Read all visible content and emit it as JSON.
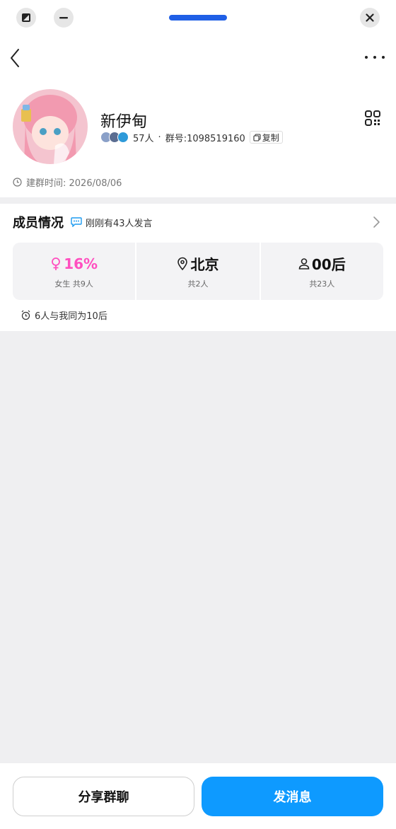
{
  "window": {
    "left_icon": "split-screen-icon",
    "minimize_icon": "minimize-icon",
    "close_icon": "close-icon"
  },
  "nav": {
    "back_icon": "back-arrow-icon",
    "more_icon": "more-dots-icon"
  },
  "group": {
    "name": "新伊甸",
    "member_count": "57人",
    "separator": "·",
    "group_number": "群号:1098519160",
    "copy_label": "复制",
    "created": "建群时间: 2026/08/06"
  },
  "members": {
    "title": "成员情况",
    "recent_activity": "刚刚有43人发言",
    "stats": [
      {
        "icon": "female-icon",
        "value": "16%",
        "sub": "女生 共9人"
      },
      {
        "icon": "location-icon",
        "value": "北京",
        "sub": "共2人"
      },
      {
        "icon": "person-icon",
        "value": "00后",
        "sub": "共23人"
      }
    ],
    "age_note": "6人与我同为10后"
  },
  "actions": {
    "share": "分享群聊",
    "send": "发消息"
  },
  "colors": {
    "accent": "#0e9aff",
    "pink": "#ff4fbf",
    "handle": "#1f5fe6"
  }
}
